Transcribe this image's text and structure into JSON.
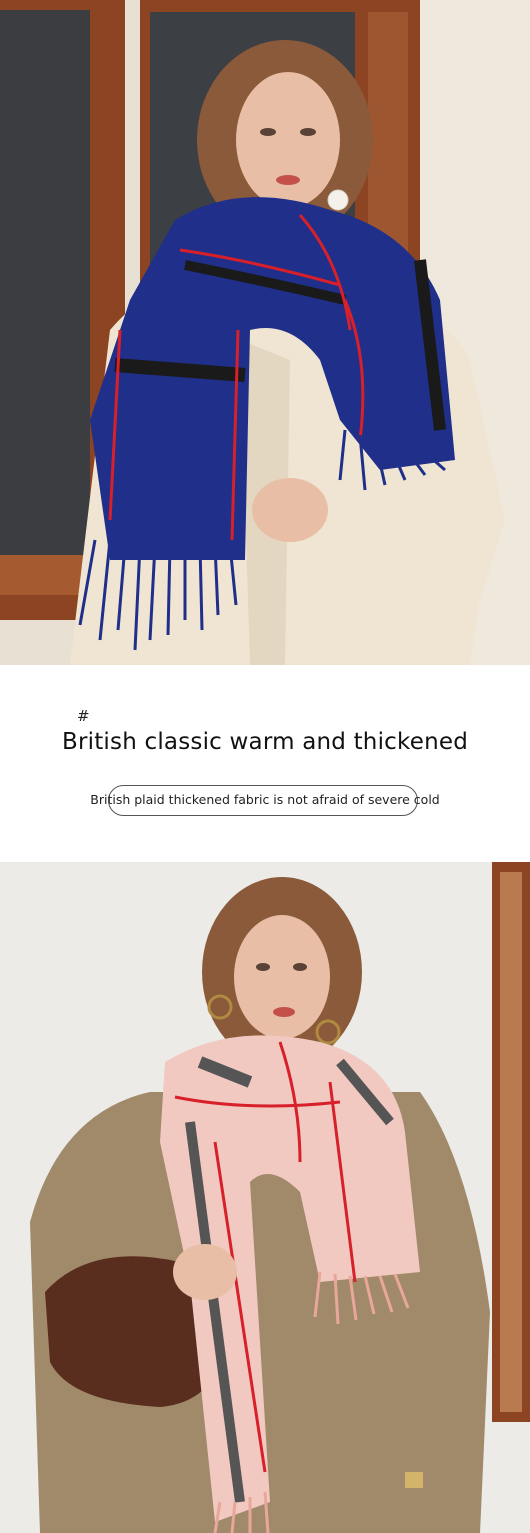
{
  "section": {
    "hash_symbol": "#",
    "headline": "British classic warm and thickened",
    "subline": "British plaid thickened fabric is not afraid of severe cold"
  },
  "colors": {
    "navy_scarf": "#1f2f8a",
    "pink_scarf": "#f1c9c0",
    "plaid_red": "#d8202b",
    "plaid_black": "#1a1a1a",
    "cream_coat": "#efe5d2",
    "window_frame": "#9a4b25",
    "sweater": "#a08a6a"
  },
  "icons": [
    "photo-model-navy-scarf",
    "photo-model-pink-scarf"
  ]
}
